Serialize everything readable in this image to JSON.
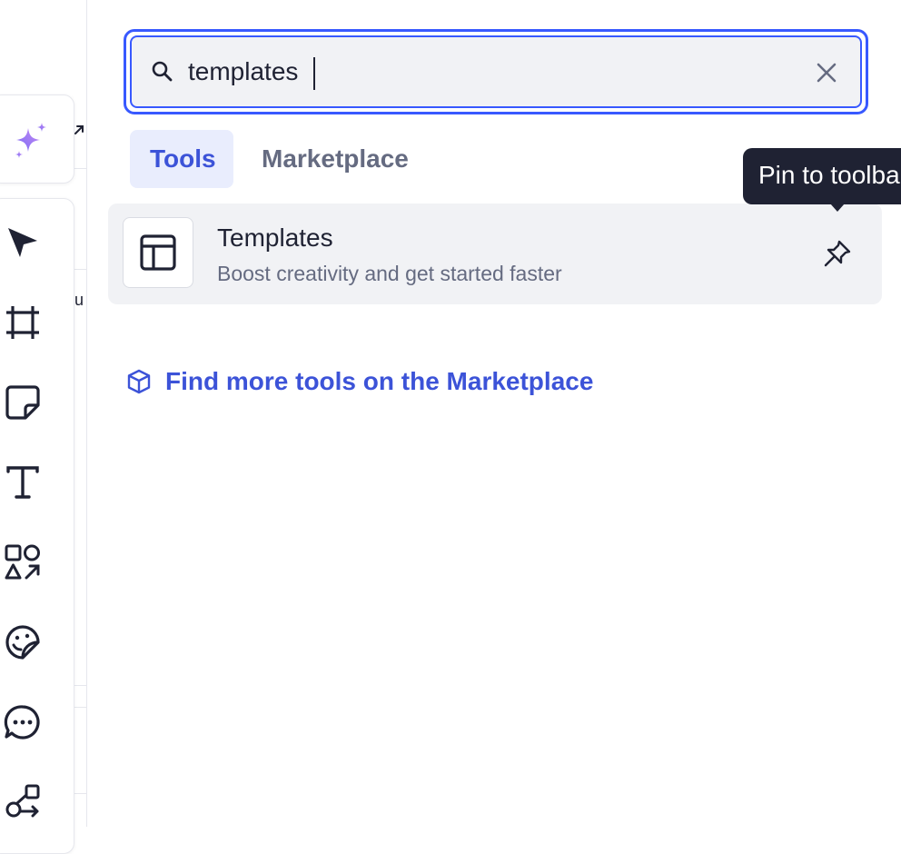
{
  "search": {
    "value": "templates",
    "placeholder": ""
  },
  "tabs": [
    {
      "label": "Tools",
      "active": true
    },
    {
      "label": "Marketplace",
      "active": false
    }
  ],
  "results": [
    {
      "title": "Templates",
      "description": "Boost creativity and get started faster",
      "icon": "layout-icon"
    }
  ],
  "tooltip": {
    "text": "Pin to toolbar"
  },
  "marketplace_link": {
    "label": "Find more tools on the Marketplace",
    "icon": "cube-icon"
  },
  "left_peek": {
    "u_text": "u"
  },
  "colors": {
    "accent": "#3c53d8",
    "accent_border": "#3859ff",
    "tab_active_bg": "#e9edfd",
    "row_bg": "#f1f2f5",
    "tooltip_bg": "#1f2233",
    "ai_gradient": [
      "#7b6cf6",
      "#c48af2"
    ]
  },
  "toolbar_icons": [
    "ai-sparkle-icon",
    "select-cursor-icon",
    "frame-icon",
    "sticky-note-icon",
    "text-icon",
    "shapes-icon",
    "sticker-icon",
    "comment-icon",
    "diagram-icon"
  ]
}
